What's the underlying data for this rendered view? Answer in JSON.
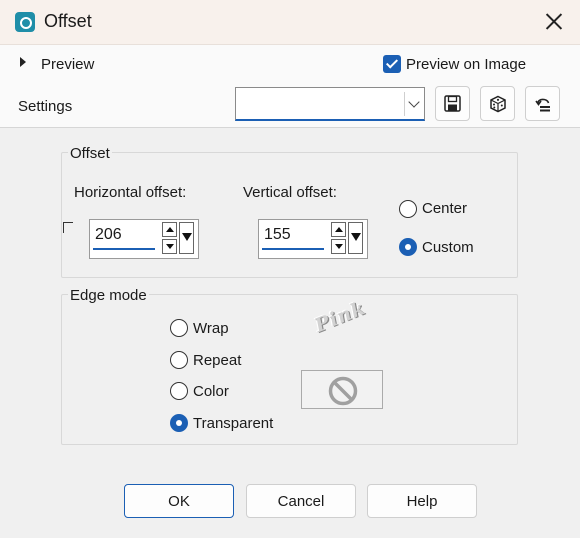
{
  "window": {
    "title": "Offset",
    "icon": "offset-app-icon"
  },
  "upper": {
    "preview_label": "Preview",
    "preview_on_image_label": "Preview on Image",
    "preview_on_image_checked": true,
    "settings_label": "Settings",
    "settings_value": "",
    "tools": [
      "save-preset-icon",
      "randomize-dice-icon",
      "reset-icon"
    ]
  },
  "offset": {
    "group_label": "Offset",
    "horizontal": {
      "label": "Horizontal offset:",
      "value": "206"
    },
    "vertical": {
      "label": "Vertical offset:",
      "value": "155"
    },
    "mode_options": [
      {
        "label": "Center",
        "checked": false
      },
      {
        "label": "Custom",
        "checked": true
      }
    ]
  },
  "edge_mode": {
    "group_label": "Edge mode",
    "options": [
      {
        "label": "Wrap",
        "checked": false
      },
      {
        "label": "Repeat",
        "checked": false
      },
      {
        "label": "Color",
        "checked": false
      },
      {
        "label": "Transparent",
        "checked": true
      }
    ],
    "color_swatch_icon": "no-color-icon"
  },
  "watermark": "Pink",
  "buttons": {
    "ok": "OK",
    "cancel": "Cancel",
    "help": "Help"
  },
  "colors": {
    "accent": "#1b5fb4",
    "titlebar_bg": "#f8f1ec",
    "dialog_bg": "#f0f0f0"
  }
}
